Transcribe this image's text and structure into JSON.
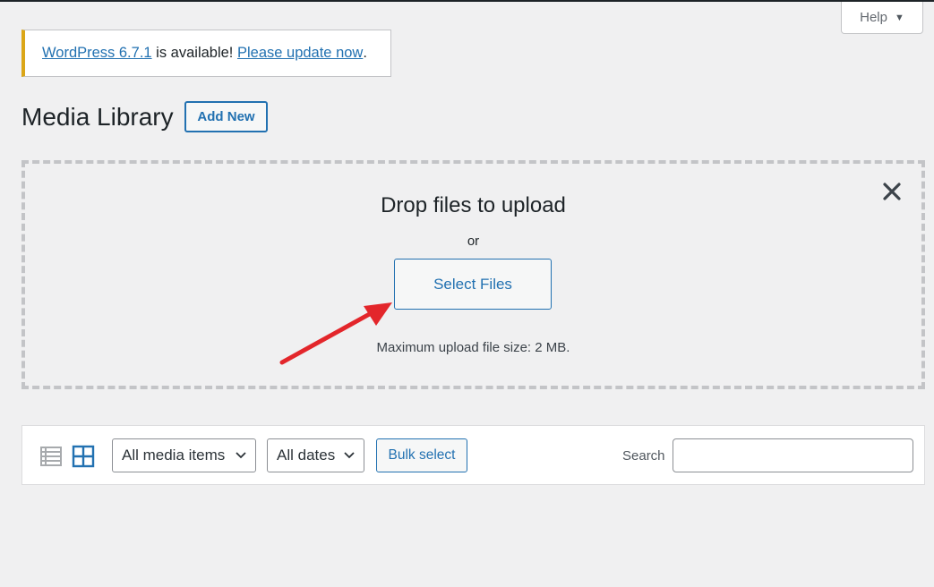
{
  "help": {
    "label": "Help",
    "caret": "▼"
  },
  "notice": {
    "version_link": "WordPress 6.7.1",
    "middle_text": " is available! ",
    "update_link": "Please update now",
    "end_text": "."
  },
  "header": {
    "title": "Media Library",
    "add_new_label": "Add New"
  },
  "uploader": {
    "drop_title": "Drop files to upload",
    "or_text": "or",
    "select_files_label": "Select Files",
    "max_size_text": "Maximum upload file size: 2 MB."
  },
  "toolbar": {
    "media_type_selected": "All media items",
    "date_selected": "All dates",
    "bulk_select_label": "Bulk select",
    "search_label": "Search",
    "search_value": ""
  },
  "colors": {
    "accent": "#2271b1",
    "notice_warning": "#dba617",
    "annotation_arrow": "#e3262b"
  }
}
